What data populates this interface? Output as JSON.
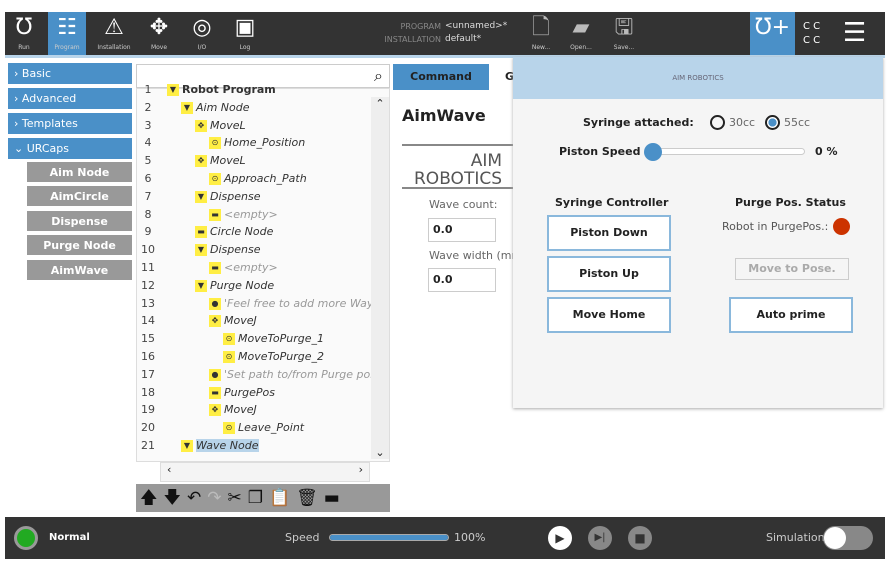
{
  "toolbar": {
    "items": [
      {
        "label": "Run",
        "icon": "ur-logo-icon"
      },
      {
        "label": "Program",
        "icon": "program-icon"
      },
      {
        "label": "Installation",
        "icon": "installation-icon"
      },
      {
        "label": "Move",
        "icon": "move-icon"
      },
      {
        "label": "I/O",
        "icon": "io-icon"
      },
      {
        "label": "Log",
        "icon": "log-icon"
      }
    ],
    "program_label": "PROGRAM",
    "program_value": "<unnamed>*",
    "installation_label": "INSTALLATION",
    "installation_value": "default*",
    "file": [
      {
        "label": "New..."
      },
      {
        "label": "Open..."
      },
      {
        "label": "Save..."
      }
    ],
    "cc": "C C"
  },
  "sidebar": {
    "items": [
      "Basic",
      "Advanced",
      "Templates",
      "URCaps"
    ],
    "urcaps": [
      "Aim Node",
      "AimCircle",
      "Dispense",
      "Purge Node",
      "AimWave"
    ]
  },
  "tree": {
    "rows": [
      {
        "n": "1",
        "t": "Robot Program",
        "d": 0
      },
      {
        "n": "2",
        "t": "Aim Node",
        "d": 1
      },
      {
        "n": "3",
        "t": "MoveL",
        "d": 2
      },
      {
        "n": "4",
        "t": "Home_Position",
        "d": 3
      },
      {
        "n": "5",
        "t": "MoveL",
        "d": 2
      },
      {
        "n": "6",
        "t": "Approach_Path",
        "d": 3
      },
      {
        "n": "7",
        "t": "Dispense",
        "d": 2
      },
      {
        "n": "8",
        "t": "<empty>",
        "d": 3
      },
      {
        "n": "9",
        "t": "Circle Node",
        "d": 2
      },
      {
        "n": "10",
        "t": "Dispense",
        "d": 2
      },
      {
        "n": "11",
        "t": "<empty>",
        "d": 3
      },
      {
        "n": "12",
        "t": "Purge Node",
        "d": 2
      },
      {
        "n": "13",
        "t": "'Feel free to add more Ways",
        "d": 3
      },
      {
        "n": "14",
        "t": "MoveJ",
        "d": 3
      },
      {
        "n": "15",
        "t": "MoveToPurge_1",
        "d": 4
      },
      {
        "n": "16",
        "t": "MoveToPurge_2",
        "d": 4
      },
      {
        "n": "17",
        "t": "'Set path to/from Purge poi",
        "d": 3
      },
      {
        "n": "18",
        "t": "PurgePos",
        "d": 3
      },
      {
        "n": "19",
        "t": "MoveJ",
        "d": 3
      },
      {
        "n": "20",
        "t": "Leave_Point",
        "d": 4
      },
      {
        "n": "21",
        "t": "Wave Node",
        "d": 1
      }
    ]
  },
  "tabs": [
    "Command",
    "G"
  ],
  "node": {
    "title": "AimWave",
    "logo": "AIM ROBOTICS",
    "wave_count_label": "Wave count:",
    "wave_count": "0.0",
    "wave_width_label": "Wave width (mn",
    "wave_width": "0.0"
  },
  "popup": {
    "logo": "AIM ROBOTICS",
    "syringe_label": "Syringe attached:",
    "opt1": "30cc",
    "opt2": "55cc",
    "selected": "55cc",
    "speed_label": "Piston Speed",
    "speed_value": "0 %",
    "speed": 0,
    "syringe_title": "Syringe Controller",
    "piston_down": "Piston Down",
    "piston_up": "Piston Up",
    "move_home": "Move Home",
    "purge_title": "Purge Pos. Status",
    "robot_in": "Robot in PurgePos.:",
    "move_pose": "Move to Pose.",
    "auto_prime": "Auto prime",
    "status_color": "#cc3300"
  },
  "bottom": {
    "status": "Normal",
    "speed_label": "Speed",
    "speed_value": "100%",
    "speed": 100,
    "simulation": "Simulation"
  }
}
